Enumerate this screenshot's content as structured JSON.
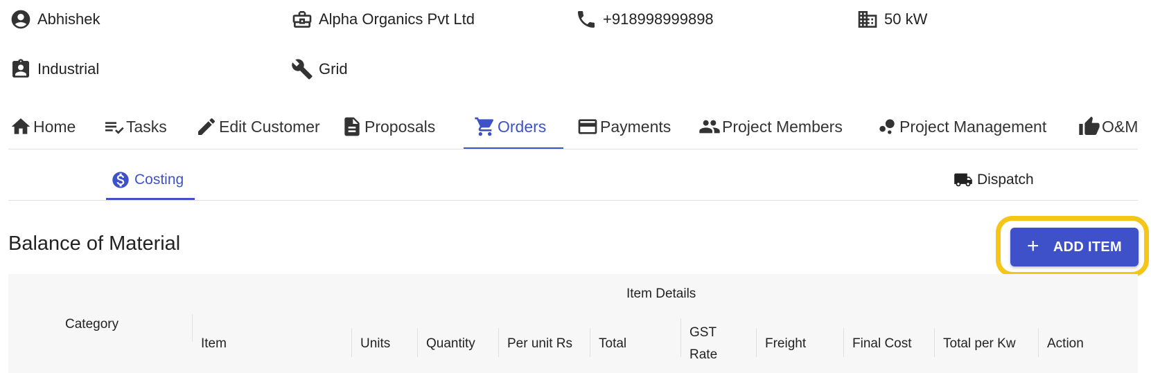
{
  "info": {
    "name": "Abhishek",
    "company": "Alpha Organics Pvt Ltd",
    "phone": "+918998999898",
    "capacity": "50 kW",
    "category": "Industrial",
    "connection": "Grid"
  },
  "nav": {
    "tabs": [
      {
        "label": "Home",
        "icon": "home-icon"
      },
      {
        "label": "Tasks",
        "icon": "tasks-icon"
      },
      {
        "label": "Edit Customer",
        "icon": "pencil-icon"
      },
      {
        "label": "Proposals",
        "icon": "document-icon"
      },
      {
        "label": "Orders",
        "icon": "cart-icon",
        "active": true
      },
      {
        "label": "Payments",
        "icon": "credit-card-icon"
      },
      {
        "label": "Project Members",
        "icon": "people-icon"
      },
      {
        "label": "Project Management",
        "icon": "bubble-chart-icon"
      },
      {
        "label": "O&M",
        "icon": "thumbs-up-icon"
      }
    ]
  },
  "subtabs": {
    "costing": "Costing",
    "dispatch": "Dispatch"
  },
  "section": {
    "title": "Balance of Material",
    "add_label": "ADD ITEM"
  },
  "table": {
    "group_header": "Item Details",
    "category_header": "Category",
    "columns": [
      "Item",
      "Units",
      "Quantity",
      "Per unit Rs",
      "Total",
      "GST",
      "Rate",
      "Freight",
      "Final Cost",
      "Total per Kw",
      "Action"
    ]
  },
  "colors": {
    "accent": "#3f51c8",
    "highlight": "#f5c518"
  }
}
